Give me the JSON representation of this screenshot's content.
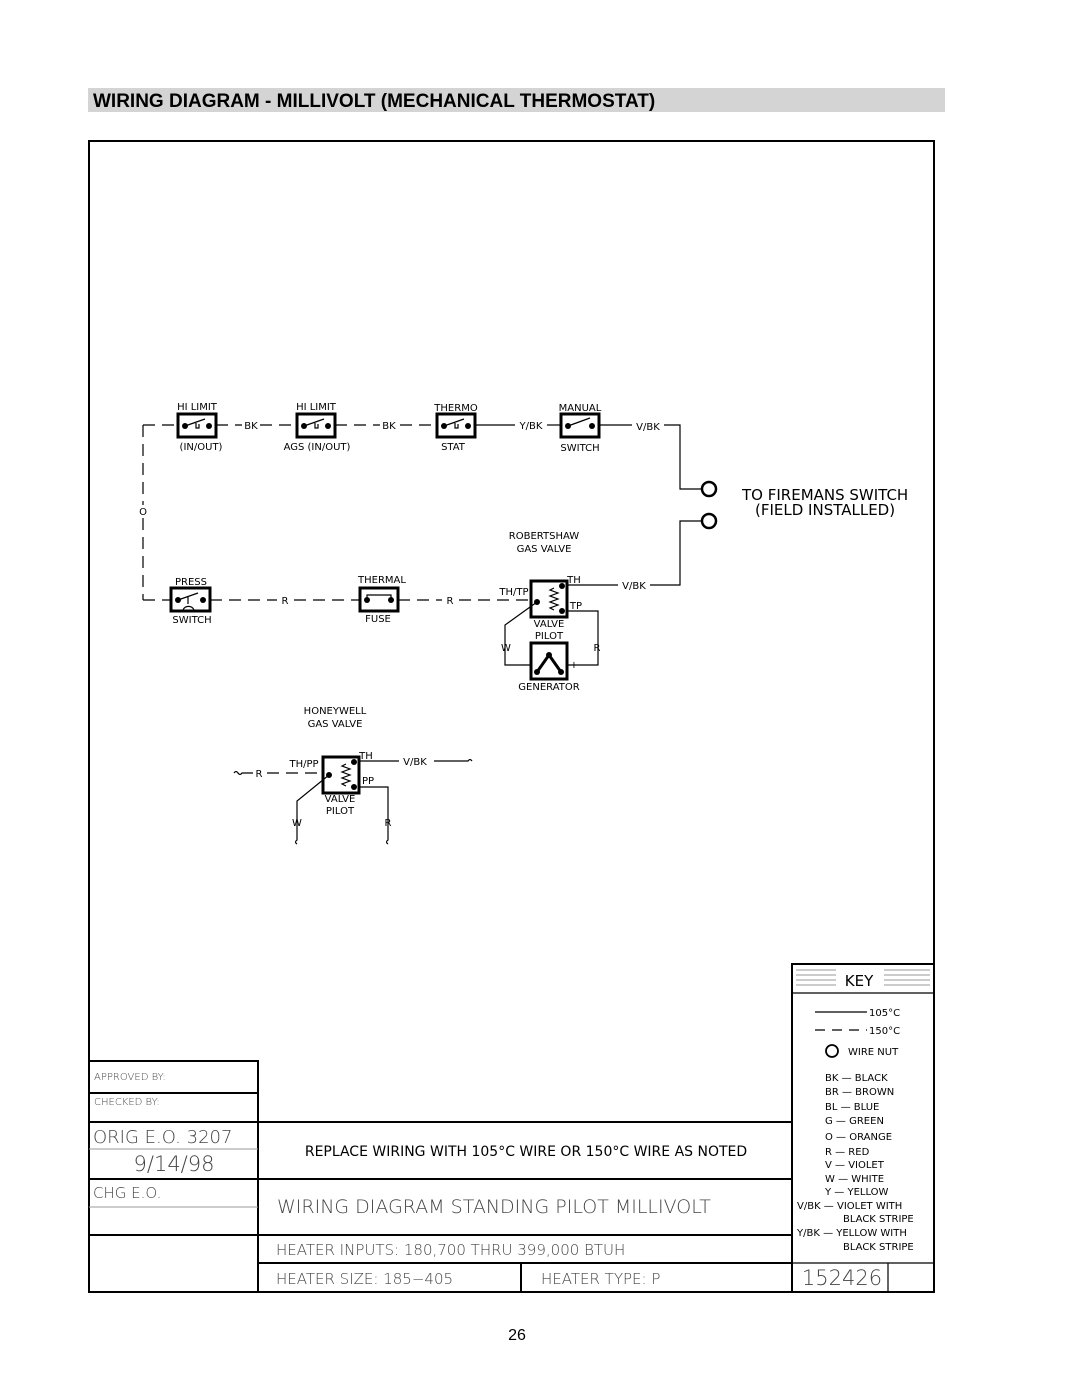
{
  "page_title": "WIRING DIAGRAM - MILLIVOLT (MECHANICAL THERMOSTAT)",
  "page_number": "26",
  "circuit": {
    "hi_limit_1": {
      "top": "HI LIMIT",
      "bottom": "(IN/OUT)"
    },
    "wire_bk_1": "BK",
    "hi_limit_2": {
      "top": "HI LIMIT",
      "bottom": "AGS (IN/OUT)"
    },
    "wire_bk_2": "BK",
    "thermostat": {
      "top": "THERMO",
      "bottom": "STAT"
    },
    "wire_ybk": "Y/BK",
    "manual_switch": {
      "top": "MANUAL",
      "bottom": "SWITCH"
    },
    "wire_vbk_top": "V/BK",
    "wire_o": "O",
    "fireman": {
      "line1": "TO FIREMANS SWITCH",
      "line2": "(FIELD INSTALLED)"
    },
    "press_switch": {
      "top": "PRESS",
      "bottom": "SWITCH"
    },
    "wire_r_1": "R",
    "thermal_fuse": {
      "top": "THERMAL",
      "bottom": "FUSE"
    },
    "wire_r_2": "R",
    "robertshaw": {
      "title1": "ROBERTSHAW",
      "title2": "GAS VALVE",
      "th_tp": "TH/TP",
      "th": "TH",
      "tp": "TP",
      "wire_vbk": "V/BK",
      "valve": "VALVE",
      "pilot": "PILOT",
      "w": "W",
      "r": "R",
      "minus": "−",
      "plus": "+",
      "generator": "GENERATOR"
    },
    "honeywell": {
      "title1": "HONEYWELL",
      "title2": "GAS VALVE",
      "r_in": "R",
      "th_pp": "TH/PP",
      "th": "TH",
      "pp": "PP",
      "wire_vbk": "V/BK",
      "valve": "VALVE",
      "pilot": "PILOT",
      "w": "W",
      "r": "R"
    }
  },
  "key": {
    "title": "KEY",
    "solid": "105°C",
    "dashed": "150°C",
    "wire_nut": "WIRE NUT",
    "colors": [
      "BK — BLACK",
      "BR — BROWN",
      "BL — BLUE",
      "G — GREEN",
      "O — ORANGE",
      "R — RED",
      "V — VIOLET",
      "W — WHITE",
      "Y — YELLOW"
    ],
    "vbk1": "V/BK — VIOLET WITH",
    "vbk2": "BLACK STRIPE",
    "ybk1": "Y/BK — YELLOW WITH",
    "ybk2": "BLACK STRIPE"
  },
  "title_block": {
    "approved_by": "APPROVED BY:",
    "checked_by": "CHECKED BY:",
    "orig_eo": "ORIG E.O.  3207",
    "date": "9/14/98",
    "chg_eo": "CHG E.O.",
    "note": "REPLACE WIRING WITH 105°C WIRE OR 150°C WIRE AS NOTED",
    "title": "WIRING DIAGRAM  STANDING PILOT  MILLIVOLT",
    "inputs": "HEATER INPUTS:  180,700  THRU  399,000  BTUH",
    "size": "HEATER SIZE:  185−405",
    "type": "HEATER TYPE:  P",
    "drawing_number": "152426"
  }
}
